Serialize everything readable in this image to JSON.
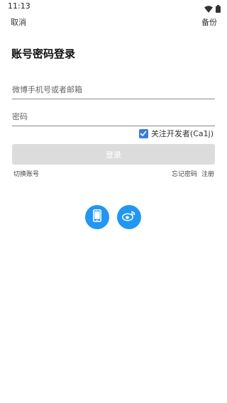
{
  "status_bar": {
    "time": "11:13"
  },
  "top_bar": {
    "cancel_label": "取消",
    "backup_label": "备份"
  },
  "page": {
    "title": "账号密码登录"
  },
  "form": {
    "account_placeholder": "微博手机号或者邮箱",
    "account_value": "",
    "password_placeholder": "密码",
    "password_value": "",
    "follow_developer_label": "关注开发者(Ca1j)",
    "follow_developer_checked": true,
    "login_label": "登录"
  },
  "links": {
    "switch_account": "切换账号",
    "forgot_password": "忘记密码",
    "register": "注册"
  },
  "colors": {
    "accent": "#2196f3",
    "checkbox": "#3d7bd6",
    "login_disabled": "#dcdcdc"
  },
  "icons": {
    "phone_login": "mobile-phone-icon",
    "weibo_login": "weibo-icon"
  }
}
